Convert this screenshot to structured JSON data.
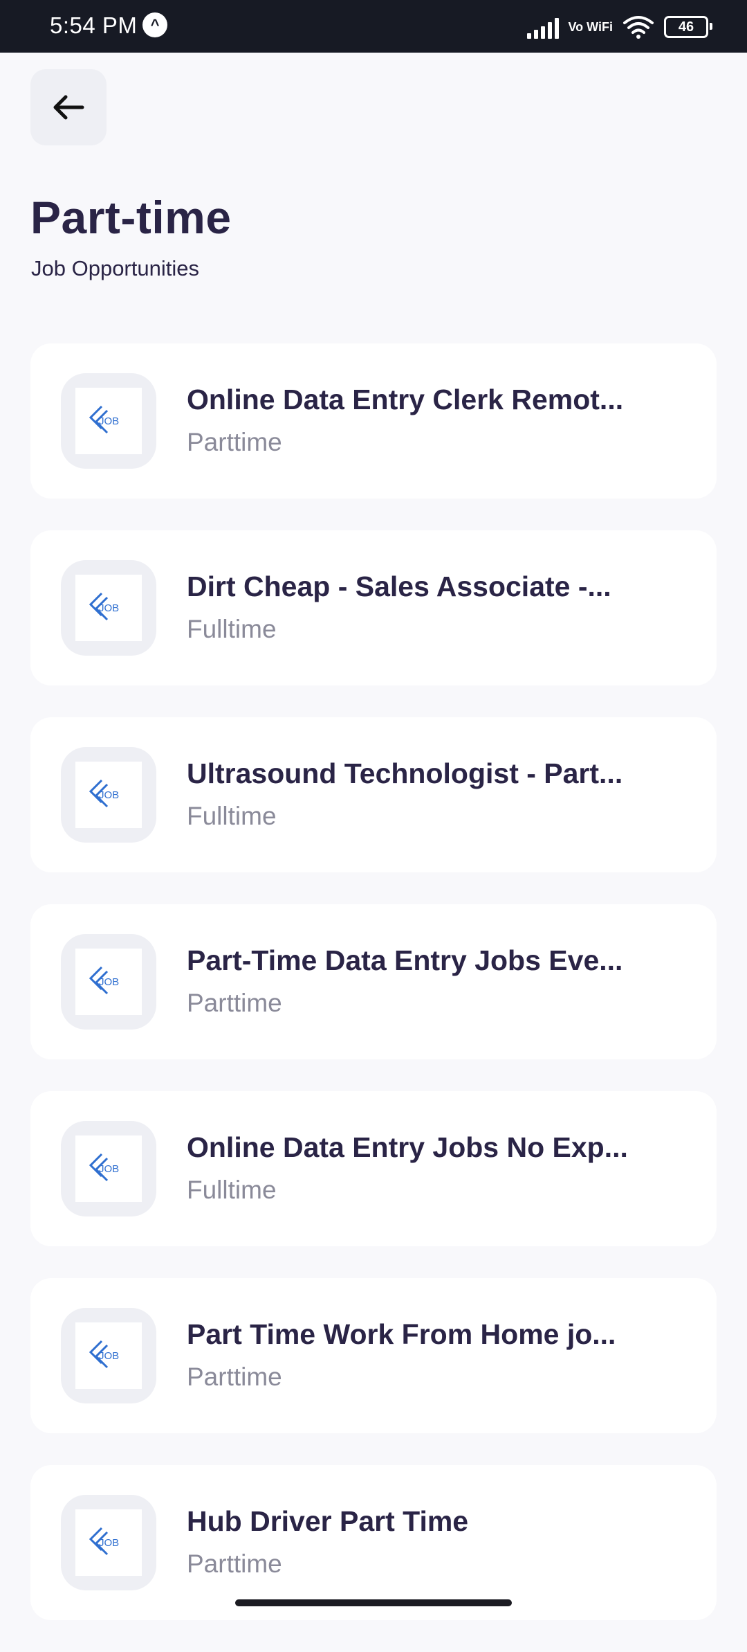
{
  "status_bar": {
    "time": "5:54 PM",
    "network": "Vo WiFi",
    "battery": "46",
    "icons": [
      "signal-icon",
      "wifi-icon",
      "battery-icon"
    ]
  },
  "header": {
    "back_icon": "arrow-left-icon",
    "title": "Part-time",
    "subtitle": "Job Opportunities"
  },
  "jobs": [
    {
      "title": "Online Data Entry Clerk Remot...",
      "type": "Parttime",
      "logo": "job-logo-icon"
    },
    {
      "title": "Dirt Cheap - Sales Associate -...",
      "type": "Fulltime",
      "logo": "job-logo-icon"
    },
    {
      "title": "Ultrasound Technologist - Part...",
      "type": "Fulltime",
      "logo": "job-logo-icon"
    },
    {
      "title": "Part-Time Data Entry Jobs Eve...",
      "type": "Parttime",
      "logo": "job-logo-icon"
    },
    {
      "title": "Online Data Entry Jobs No Exp...",
      "type": "Fulltime",
      "logo": "job-logo-icon"
    },
    {
      "title": "Part Time Work From Home jo...",
      "type": "Parttime",
      "logo": "job-logo-icon"
    },
    {
      "title": "Hub Driver Part Time",
      "type": "Parttime",
      "logo": "job-logo-icon"
    }
  ],
  "colors": {
    "background": "#f8f8fb",
    "title": "#2a2446",
    "subtitle_gray": "#8a8a99",
    "logo_blue": "#2f6fd0",
    "status_bar": "#171a24"
  }
}
